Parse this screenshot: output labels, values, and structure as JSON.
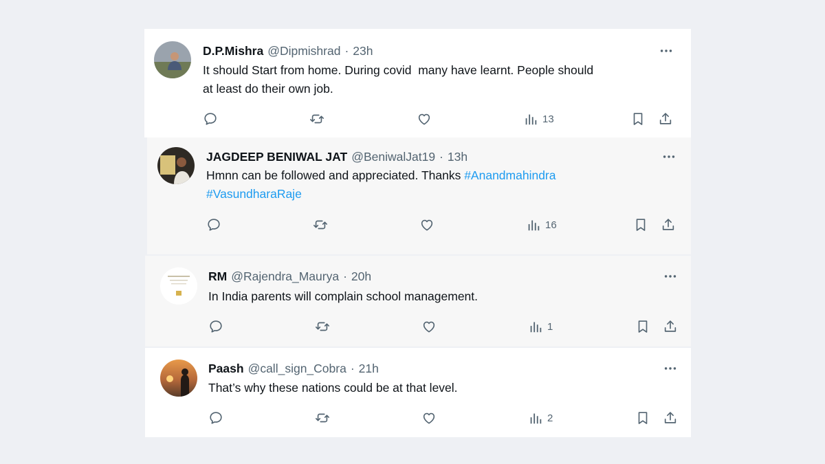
{
  "tweets": [
    {
      "name": "D.P.Mishra",
      "handle": "@Dipmishrad",
      "time": "23h",
      "line1": "It should Start from home. During covid  many have learnt. People should",
      "line2": "at least do their own job.",
      "views": "13"
    },
    {
      "name": "JAGDEEP BENIWAL JAT",
      "handle": "@BeniwalJat19",
      "time": "13h",
      "line1": "Hmnn can be followed and appreciated. Thanks ",
      "hashtag1": "#Anandmahindra",
      "hashtag2": "#VasundharaRaje",
      "views": "16"
    },
    {
      "name": "RM",
      "handle": "@Rajendra_Maurya",
      "time": "20h",
      "line1": "In India parents will complain school management.",
      "views": "1"
    },
    {
      "name": "Paash",
      "handle": "@call_sign_Cobra",
      "time": "21h",
      "line1": "That’s why these nations could be at that level.",
      "views": "2"
    }
  ],
  "separator": "·",
  "icons": [
    "reply-icon",
    "retweet-icon",
    "like-icon",
    "views-icon",
    "bookmark-icon",
    "share-icon",
    "more-icon"
  ],
  "colors": {
    "text": "#0f1419",
    "muted": "#536471",
    "link": "#1d9bf0",
    "background": "#eef0f4"
  }
}
